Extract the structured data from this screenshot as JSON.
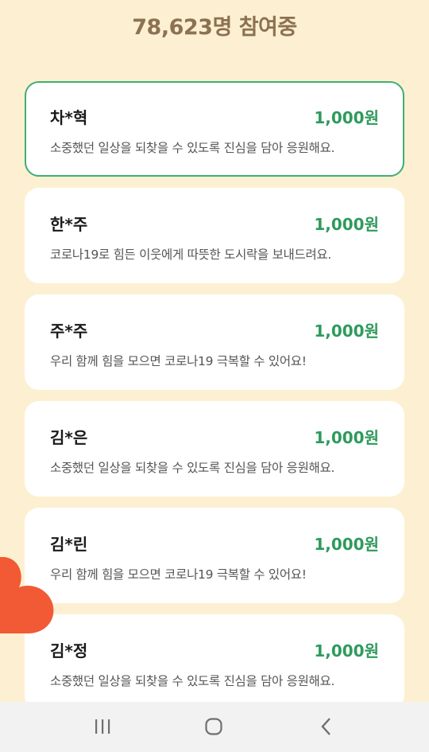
{
  "header": {
    "participants_text": "78,623명 참여중"
  },
  "cards": [
    {
      "name": "차*혁",
      "amount": "1,000원",
      "message": "소중했던 일상을 되찾을 수 있도록 진심을 담아 응원해요.",
      "highlighted": true
    },
    {
      "name": "한*주",
      "amount": "1,000원",
      "message": "코로나19로 힘든 이웃에게 따뜻한 도시락을 보내드려요.",
      "highlighted": false
    },
    {
      "name": "주*주",
      "amount": "1,000원",
      "message": "우리 함께 힘을 모으면 코로나19 극복할 수 있어요!",
      "highlighted": false
    },
    {
      "name": "김*은",
      "amount": "1,000원",
      "message": "소중했던 일상을 되찾을 수 있도록 진심을 담아 응원해요.",
      "highlighted": false
    },
    {
      "name": "김*린",
      "amount": "1,000원",
      "message": "우리 함께 힘을 모으면 코로나19 극복할 수 있어요!",
      "highlighted": false
    },
    {
      "name": "김*정",
      "amount": "1,000원",
      "message": "소중했던 일상을 되찾을 수 있도록 진심을 담아 응원해요.",
      "highlighted": false
    }
  ],
  "decor": {
    "heart_icon": "heart-icon",
    "heart_color": "#f15a35"
  },
  "navbar": {
    "recents_icon": "recent-apps-icon",
    "home_icon": "home-icon",
    "back_icon": "back-icon"
  },
  "colors": {
    "background": "#fdf0d2",
    "header_text": "#8c7152",
    "amount_green": "#2f9a5c",
    "highlight_border": "#3fae72"
  }
}
